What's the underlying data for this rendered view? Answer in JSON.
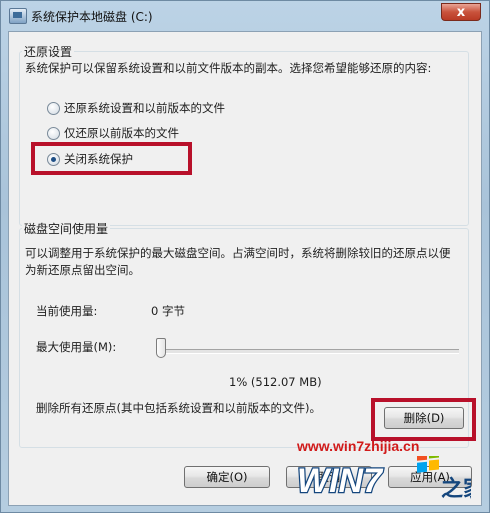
{
  "window": {
    "title": "系统保护本地磁盘 (C:)",
    "close_label": "x"
  },
  "restore": {
    "group_title": "还原设置",
    "description": "系统保护可以保留系统设置和以前文件版本的副本。选择您希望能够还原的内容:",
    "options": [
      {
        "label": "还原系统设置和以前版本的文件",
        "checked": false
      },
      {
        "label": "仅还原以前版本的文件",
        "checked": false
      },
      {
        "label": "关闭系统保护",
        "checked": true
      }
    ]
  },
  "disk": {
    "group_title": "磁盘空间使用量",
    "description": "可以调整用于系统保护的最大磁盘空间。占满空间时，系统将删除较旧的还原点以便为新还原点留出空间。",
    "current_usage_label": "当前使用量:",
    "current_usage_value": "0 字节",
    "max_usage_label": "最大使用量(M):",
    "max_usage_readout": "1% (512.07 MB)",
    "max_usage_percent": 1
  },
  "delete": {
    "description": "删除所有还原点(其中包括系统设置和以前版本的文件)。",
    "button_label": "删除(D)"
  },
  "footer": {
    "ok_label": "确定(O)",
    "cancel_label": "取消",
    "apply_label": "应用(A)"
  },
  "watermark": {
    "url": "www.win7zhijia.cn",
    "logo_text": "WIN7",
    "logo_suffix": "之家"
  },
  "colors": {
    "highlight": "#b8102a",
    "selected_radio": "#1f4f86",
    "watermark": "#d11a1a"
  }
}
